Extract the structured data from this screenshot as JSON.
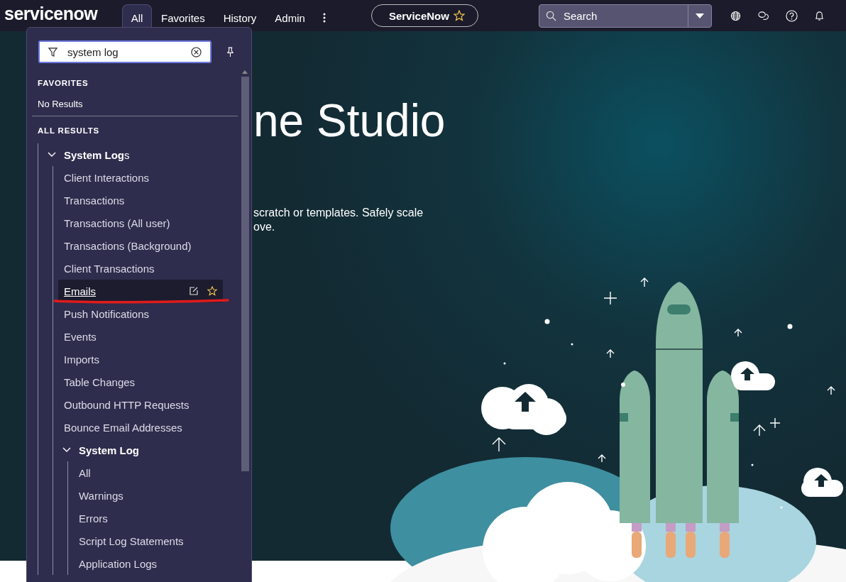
{
  "header": {
    "logo": "servicenow",
    "tabs": [
      {
        "label": "All",
        "selected": true
      },
      {
        "label": "Favorites",
        "selected": false
      },
      {
        "label": "History",
        "selected": false
      },
      {
        "label": "Admin",
        "selected": false
      }
    ],
    "scope_pill": {
      "label": "ServiceNow"
    },
    "search": {
      "placeholder": "Search"
    }
  },
  "nav_menu": {
    "filter": {
      "value": "system log"
    },
    "favorites": {
      "heading": "FAVORITES",
      "empty_text": "No Results"
    },
    "all_results": {
      "heading": "ALL RESULTS",
      "tree": [
        {
          "label": "**System Log**s",
          "expanded": true,
          "children": [
            {
              "label": "Client Interactions",
              "selected": false
            },
            {
              "label": "Transactions",
              "selected": false
            },
            {
              "label": "Transactions (All user)",
              "selected": false
            },
            {
              "label": "Transactions (Background)",
              "selected": false
            },
            {
              "label": "Client Transactions",
              "selected": false
            },
            {
              "label": "Emails",
              "selected": true
            },
            {
              "label": "Push Notifications",
              "selected": false
            },
            {
              "label": "Events",
              "selected": false
            },
            {
              "label": "Imports",
              "selected": false
            },
            {
              "label": "Table Changes",
              "selected": false
            },
            {
              "label": "Outbound HTTP Requests",
              "selected": false
            },
            {
              "label": "Bounce Email Addresses",
              "selected": false
            },
            {
              "label": "**System Log**",
              "expanded": true,
              "children": [
                {
                  "label": "All",
                  "selected": false
                },
                {
                  "label": "Warnings",
                  "selected": false
                },
                {
                  "label": "Errors",
                  "selected": false
                },
                {
                  "label": "Script Log Statements",
                  "selected": false
                },
                {
                  "label": "Application Logs",
                  "selected": false
                }
              ]
            }
          ]
        }
      ]
    }
  },
  "hero": {
    "title": "ne Studio",
    "description_lines": [
      "scratch or templates. Safely scale",
      "ove."
    ]
  }
}
